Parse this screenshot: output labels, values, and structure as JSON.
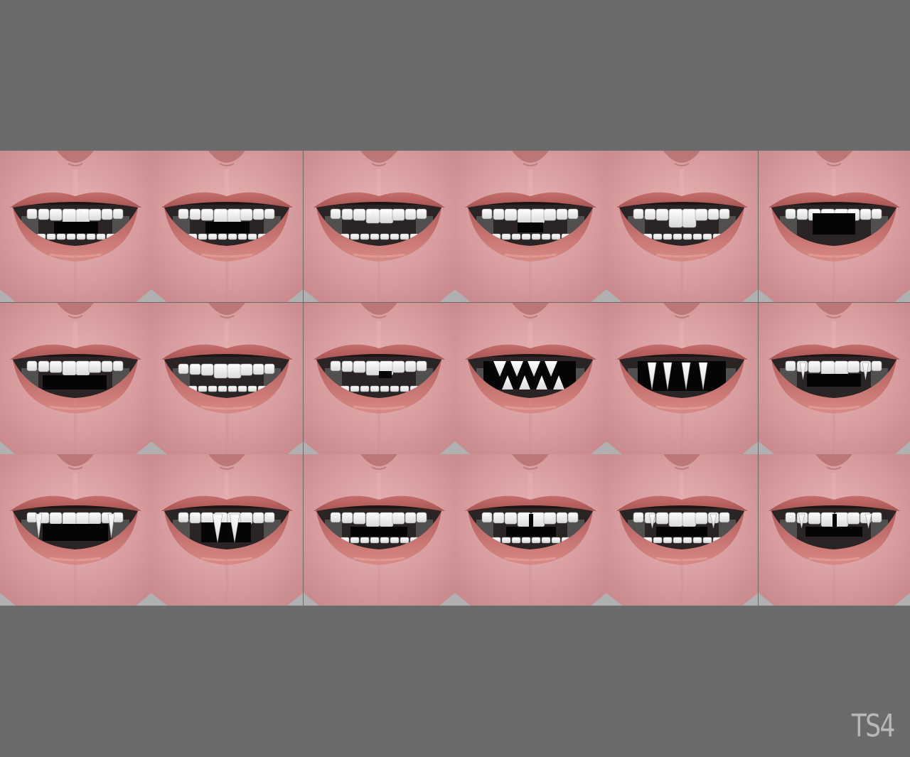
{
  "watermark": "TS4",
  "grid": {
    "rows": 3,
    "columns": 6,
    "tiles": [
      {
        "style": "gems-gap"
      },
      {
        "style": "gems-gap"
      },
      {
        "style": "gems-normal"
      },
      {
        "style": "gap-small"
      },
      {
        "style": "big-incisors"
      },
      {
        "style": "missing-center"
      },
      {
        "style": "missing-lower"
      },
      {
        "style": "crooked"
      },
      {
        "style": "chipped"
      },
      {
        "style": "fangs-triangle"
      },
      {
        "style": "fangs-long"
      },
      {
        "style": "fangs-side"
      },
      {
        "style": "fangs-side-long"
      },
      {
        "style": "fang-single-center"
      },
      {
        "style": "normal-gap"
      },
      {
        "style": "gap-center"
      },
      {
        "style": "fangs-small"
      },
      {
        "style": "gap-center-fangs"
      }
    ]
  }
}
